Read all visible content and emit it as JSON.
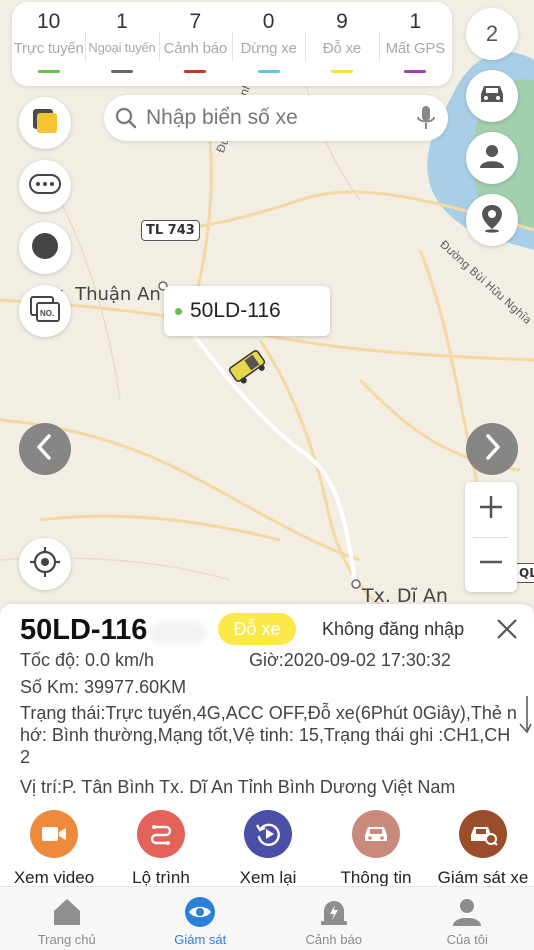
{
  "status_bar": {
    "items": [
      {
        "count": "10",
        "label": "Trực tuyến",
        "color": "#6abf4b"
      },
      {
        "count": "1",
        "label": "Ngoại tuyến",
        "color": "#666666"
      },
      {
        "count": "7",
        "label": "Cảnh báo",
        "color": "#c0392b"
      },
      {
        "count": "0",
        "label": "Dừng xe",
        "color": "#5ec8e0"
      },
      {
        "count": "9",
        "label": "Đỗ xe",
        "color": "#f3e03b"
      },
      {
        "count": "1",
        "label": "Mất GPS",
        "color": "#a23fb5"
      }
    ],
    "badge": "2"
  },
  "search": {
    "placeholder": "Nhập biển số xe"
  },
  "map": {
    "labels": {
      "road_tl743": "TL 743",
      "road_duong_huynh": "Đường Huỳnh",
      "road_bui_huu_nghia": "Đường Bùi Hữu Nghĩa",
      "town_thuan_an": "Tx. Thuận An",
      "town_di_an": "Tx. Dĩ An",
      "road_ql": "QL"
    },
    "vehicle_popup": {
      "plate": "50LD-116",
      "dot_color": "#6abf4b"
    }
  },
  "info": {
    "plate": "50LD-116",
    "state_badge": "Đỗ xe",
    "login_state": "Không đăng nhập",
    "speed": "Tốc độ: 0.0 km/h",
    "time": "Giờ:2020-09-02 17:30:32",
    "km": "Số Km: 39977.60KM",
    "status": "Trạng thái:Trực tuyến,4G,ACC OFF,Đỗ xe(6Phút 0Giây),Thẻ nhớ: Bình thường,Mạng tốt,Vệ tinh: 15,Trạng thái ghi :CH1,CH2",
    "location": "Vị trí:P. Tân Bình Tx. Dĩ An Tỉnh Bình Dương Việt Nam"
  },
  "actions": [
    {
      "label": "Xem video",
      "icon": "video-camera-icon",
      "color": "#ee8a3a"
    },
    {
      "label": "Lộ trình",
      "icon": "route-icon",
      "color": "#e3625a"
    },
    {
      "label": "Xem lại",
      "icon": "replay-icon",
      "color": "#4b4fa8"
    },
    {
      "label": "Thông tin",
      "icon": "car-info-icon",
      "color": "#c98a7d"
    },
    {
      "label": "Giám sát xe",
      "icon": "car-monitor-icon",
      "color": "#9a4d2a"
    }
  ],
  "bottom_nav": [
    {
      "label": "Trang chủ",
      "icon": "home-icon",
      "active": false
    },
    {
      "label": "Giám sát",
      "icon": "eye-icon",
      "active": true
    },
    {
      "label": "Cảnh báo",
      "icon": "alarm-icon",
      "active": false
    },
    {
      "label": "Của tôi",
      "icon": "user-icon",
      "active": false
    }
  ]
}
